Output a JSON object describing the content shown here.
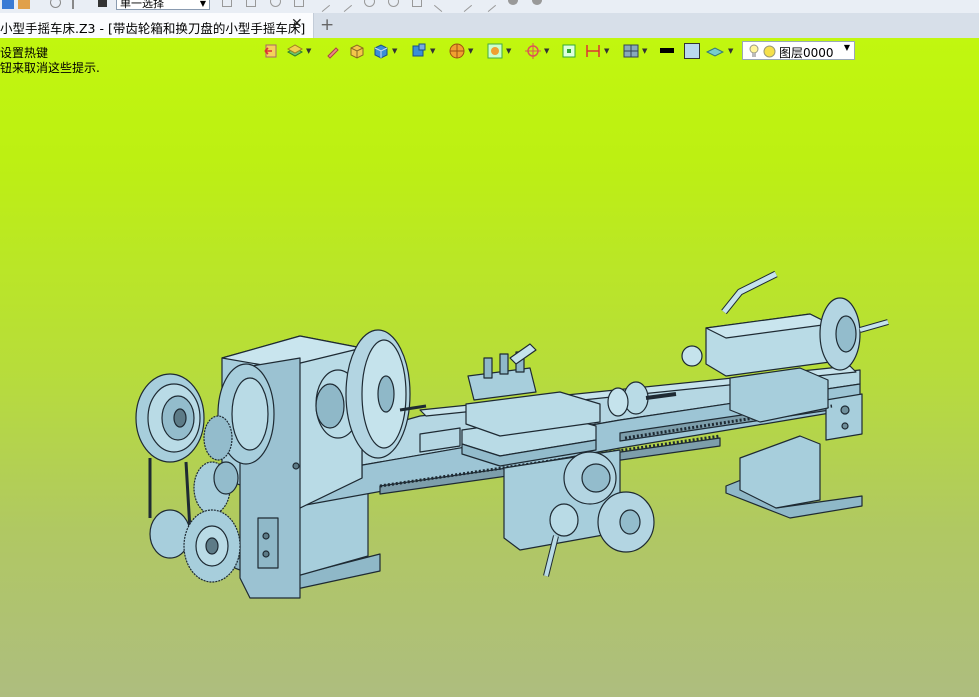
{
  "toolbar": {
    "select_mode": "单一选择",
    "icons": [
      "app-icon",
      "open-icon",
      "pick-icon",
      "filter-icon",
      "cursor-icon",
      "cursor-alt-icon",
      "rotate-icon",
      "node-icon",
      "line-icon",
      "arrow-icon",
      "circle-icon",
      "redo-icon",
      "vertex-icon",
      "gear-icon"
    ]
  },
  "tab": {
    "title": "小型手摇车床.Z3 - [带齿轮箱和换刀盘的小型手摇车床]",
    "close": "✕",
    "add": "+"
  },
  "hints": {
    "line1": "设置热键",
    "line2": "钮来取消这些提示."
  },
  "view_toolbar": {
    "icons": [
      "view-back-icon",
      "layers-icon",
      "pen-icon",
      "box-shade-icon",
      "cube-icon",
      "cube-view-icon",
      "sphere-icon",
      "render-icon",
      "target-icon",
      "fit-icon",
      "dimension-icon",
      "grid-icon",
      "line-color",
      "fill-color",
      "plane-icon",
      "bulb-icon"
    ],
    "layer": "图层0000"
  },
  "colors": {
    "model": "#9fc7d6",
    "background_top": "#c1f70f",
    "background_bottom": "#aebd7f"
  }
}
